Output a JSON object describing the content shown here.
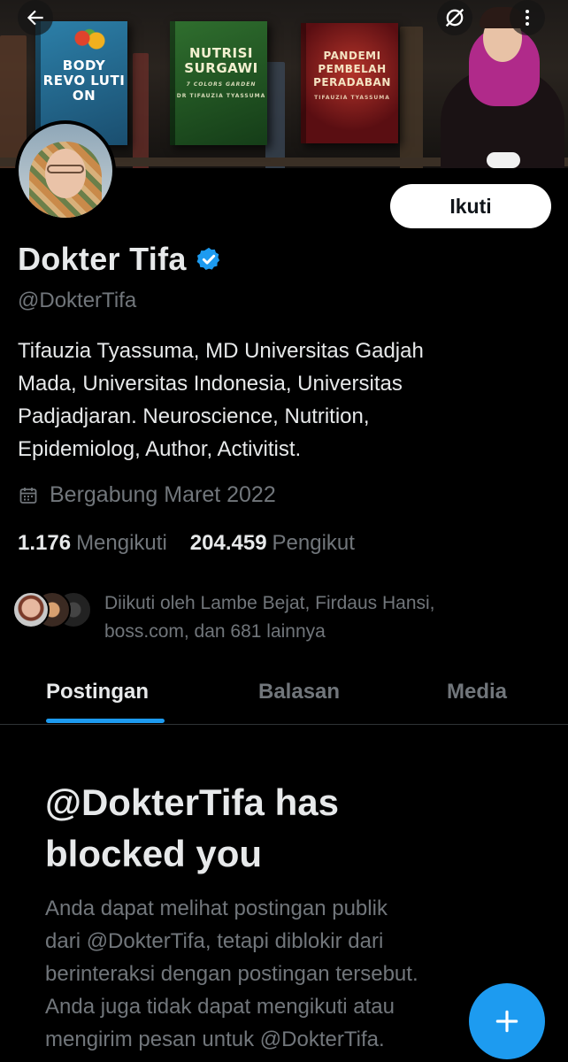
{
  "header": {
    "back_icon": "arrow-left-icon",
    "hide_media_icon": "image-off-icon",
    "more_icon": "more-vertical-icon"
  },
  "banner": {
    "books": [
      {
        "title": "BODY REVO LUTI ON"
      },
      {
        "title": "NUTRISI SURGAWI",
        "subtitle": "7 COLORS GARDEN",
        "author": "DR TIFAUZIA TYASSUMA"
      },
      {
        "title": "PANDEMI PEMBELAH PERADABAN",
        "author": "TIFAUZIA TYASSUMA"
      }
    ]
  },
  "profile": {
    "name": "Dokter Tifa",
    "verified": true,
    "handle": "@DokterTifa",
    "follow_label": "Ikuti",
    "bio_lines": [
      "Tifauzia Tyassuma, MD  Universitas  Gadjah",
      "Mada,  Universitas Indonesia, Universitas",
      "Padjadjaran. Neuroscience, Nutrition,",
      "Epidemiolog, Author,  Activitist."
    ],
    "joined": "Bergabung Maret 2022",
    "following_count": "1.176",
    "following_label": "Mengikuti",
    "followers_count": "204.459",
    "followers_label": "Pengikut",
    "followed_by_lines": [
      "Diikuti oleh Lambe Bejat, Firdaus Hansi,",
      "boss.com, dan 681 lainnya"
    ]
  },
  "tabs": [
    {
      "label": "Postingan",
      "active": true
    },
    {
      "label": "Balasan",
      "active": false
    },
    {
      "label": "Media",
      "active": false
    }
  ],
  "blocked": {
    "title_lines": [
      "@DokterTifa has",
      "blocked you"
    ],
    "desc_lines": [
      "Anda dapat melihat postingan publik",
      "dari @DokterTifa, tetapi diblokir dari",
      "berinteraksi dengan postingan tersebut.",
      "Anda juga tidak dapat mengikuti atau",
      "mengirim pesan untuk @DokterTifa."
    ]
  },
  "fab": {
    "icon": "plus-icon"
  },
  "colors": {
    "accent": "#1d9bf0",
    "background": "#000000",
    "text_primary": "#e7e9ea",
    "text_secondary": "#71767b"
  }
}
